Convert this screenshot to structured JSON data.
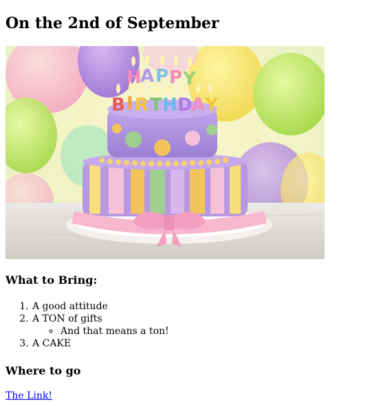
{
  "page": {
    "title": "On the 2nd of September",
    "image": {
      "alt_topic": "birthday-cake",
      "candle_letters": [
        "H",
        "A",
        "P",
        "P",
        "Y",
        "B",
        "I",
        "R",
        "T",
        "H",
        "D",
        "A",
        "Y"
      ]
    },
    "bring": {
      "heading": "What to Bring:",
      "items": [
        {
          "text": "A good attitude"
        },
        {
          "text": "A TON of gifts",
          "sub": [
            "And that means a ton!"
          ]
        },
        {
          "text": "A CAKE"
        }
      ]
    },
    "where": {
      "heading": "Where to go",
      "link_text": "The Link!"
    }
  },
  "colors": {
    "link": "#0000ee",
    "tier_top": "#a98bd6",
    "tier_bottom": "#b99be0",
    "ribbon": "#f7b8cf"
  }
}
